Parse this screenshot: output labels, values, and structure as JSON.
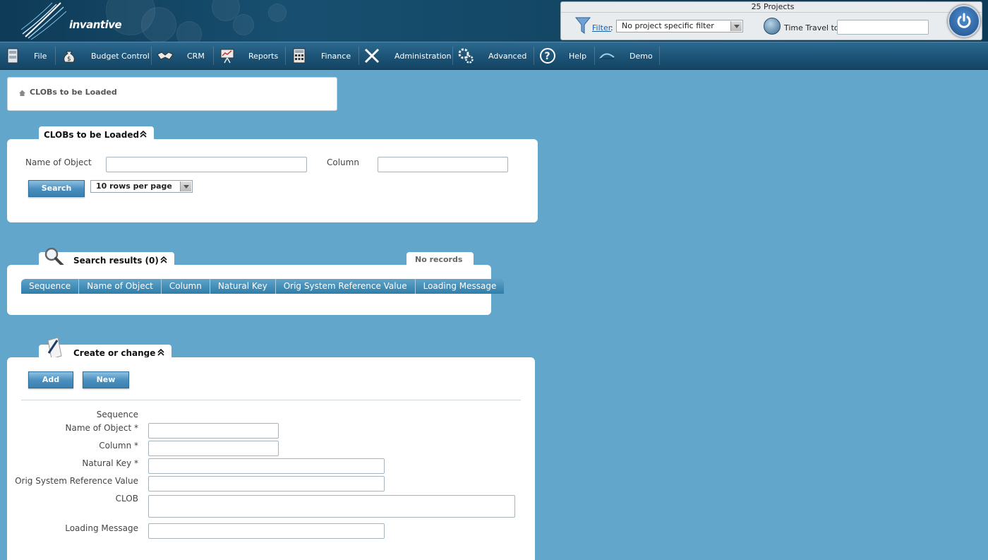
{
  "header": {
    "brand": "invantive",
    "project_count": "25 Projects",
    "filter_link": "Filter",
    "filter_colon": ":",
    "filter_value": "No project specific filter",
    "time_travel_label": "Time Travel to:",
    "time_travel_value": ""
  },
  "menu": {
    "items": [
      {
        "label": "File",
        "icon": "cabinet-icon"
      },
      {
        "label": "Budget Control",
        "icon": "money-bag-icon"
      },
      {
        "label": "CRM",
        "icon": "handshake-icon"
      },
      {
        "label": "Reports",
        "icon": "presentation-icon"
      },
      {
        "label": "Finance",
        "icon": "calculator-icon"
      },
      {
        "label": "Administration",
        "icon": "tools-icon"
      },
      {
        "label": "Advanced",
        "icon": "gears-icon"
      },
      {
        "label": "Help",
        "icon": "question-icon"
      },
      {
        "label": "Demo",
        "icon": "demo-icon"
      }
    ]
  },
  "breadcrumb": {
    "home_icon": "home-icon",
    "current": "CLOBs to be Loaded"
  },
  "search_panel": {
    "tab_title": "CLOBs to be Loaded",
    "name_of_object_label": "Name of Object",
    "name_of_object_value": "",
    "column_label": "Column",
    "column_value": "",
    "search_button": "Search",
    "rows_per_page": "10 rows per page"
  },
  "results_panel": {
    "tab_title": "Search results (0)",
    "status": "No records",
    "columns": [
      "Sequence",
      "Name of Object",
      "Column",
      "Natural Key",
      "Orig System Reference Value",
      "Loading Message"
    ]
  },
  "edit_panel": {
    "tab_title": "Create or change",
    "add_button": "Add",
    "new_button": "New",
    "fields": {
      "sequence": "Sequence",
      "name_of_object": "Name of Object *",
      "column": "Column *",
      "natural_key": "Natural Key *",
      "orig_ref": "Orig System Reference Value",
      "clob": "CLOB",
      "loading_message": "Loading Message"
    }
  },
  "colors": {
    "page_background": "#62a6cb",
    "header_background": "#124663",
    "grid_header": "#3f8ab5",
    "button": "#4b90bf"
  }
}
